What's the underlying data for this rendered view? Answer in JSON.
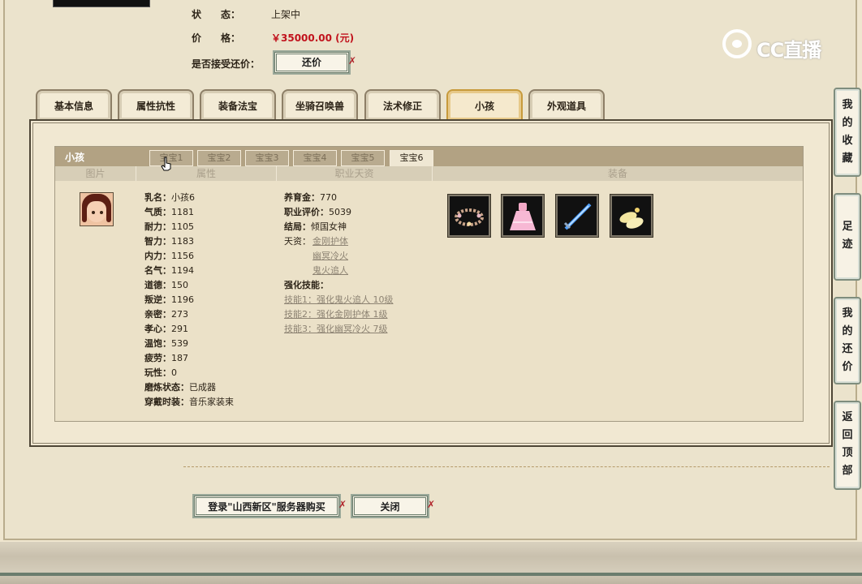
{
  "details": {
    "status_label": "状　　态：",
    "status_value": "上架中",
    "price_label": "价　　格：",
    "price_value": "￥35000.00 (元)",
    "bargain_label": "是否接受还价：",
    "bargain_button": "还价"
  },
  "logo": {
    "text": "CC直播"
  },
  "tabs": [
    {
      "label": "基本信息"
    },
    {
      "label": "属性抗性"
    },
    {
      "label": "装备法宝"
    },
    {
      "label": "坐骑召唤兽"
    },
    {
      "label": "法术修正"
    },
    {
      "label": "小孩",
      "active": true
    },
    {
      "label": "外观道具"
    }
  ],
  "child_panel": {
    "title": "小孩",
    "subtabs": [
      {
        "label": "宝宝1",
        "active": false
      },
      {
        "label": "宝宝2",
        "active": false
      },
      {
        "label": "宝宝3",
        "active": false
      },
      {
        "label": "宝宝4",
        "active": false
      },
      {
        "label": "宝宝5",
        "active": false
      },
      {
        "label": "宝宝6",
        "active": true
      }
    ],
    "columns": {
      "image": "图片",
      "attributes": "属性",
      "career": "职业天资",
      "equipment": "装备"
    },
    "attributes": [
      {
        "k": "乳名：",
        "v": "小孩6"
      },
      {
        "k": "气质：",
        "v": "1181"
      },
      {
        "k": "耐力：",
        "v": "1105"
      },
      {
        "k": "智力：",
        "v": "1183"
      },
      {
        "k": "内力：",
        "v": "1156"
      },
      {
        "k": "名气：",
        "v": "1194"
      },
      {
        "k": "道德：",
        "v": "150"
      },
      {
        "k": "叛逆：",
        "v": "1196"
      },
      {
        "k": "亲密：",
        "v": "273"
      },
      {
        "k": "孝心：",
        "v": "291"
      },
      {
        "k": "温饱：",
        "v": "539"
      },
      {
        "k": "疲劳：",
        "v": "187"
      },
      {
        "k": "玩性：",
        "v": "0"
      },
      {
        "k": "磨炼状态：",
        "v": "已成器"
      },
      {
        "k": "穿戴时装：",
        "v": "音乐家装束"
      }
    ],
    "career": {
      "fund_label": "养育金：",
      "fund_value": "770",
      "rating_label": "职业评价：",
      "rating_value": "5039",
      "ending_label": "结局：",
      "ending_value": "倾国女神",
      "talent_label": "天资：",
      "talents": [
        "金刚护体",
        "幽冥冷火",
        "鬼火追人"
      ],
      "skills_label": "强化技能：",
      "skills": [
        "技能1：强化鬼火追人 10级",
        "技能2：强化金刚护体 1级",
        "技能3：强化幽冥冷火 7级"
      ]
    },
    "equipment_icons": [
      "flower-wreath-icon",
      "pink-dress-icon",
      "blue-sword-icon",
      "yellow-shoes-icon"
    ]
  },
  "actions": {
    "buy_button": "登录\"山西新区\"服务器购买",
    "close_button": "关闭"
  },
  "side_buttons": [
    {
      "label": "我的收藏",
      "chars": [
        "我",
        "的",
        "收",
        "藏"
      ]
    },
    {
      "label": "足迹",
      "chars": [
        "足",
        "迹"
      ]
    },
    {
      "label": "我的还价",
      "chars": [
        "我",
        "的",
        "还",
        "价"
      ]
    },
    {
      "label": "返回顶部",
      "chars": [
        "返",
        "回",
        "顶",
        "部"
      ]
    }
  ]
}
